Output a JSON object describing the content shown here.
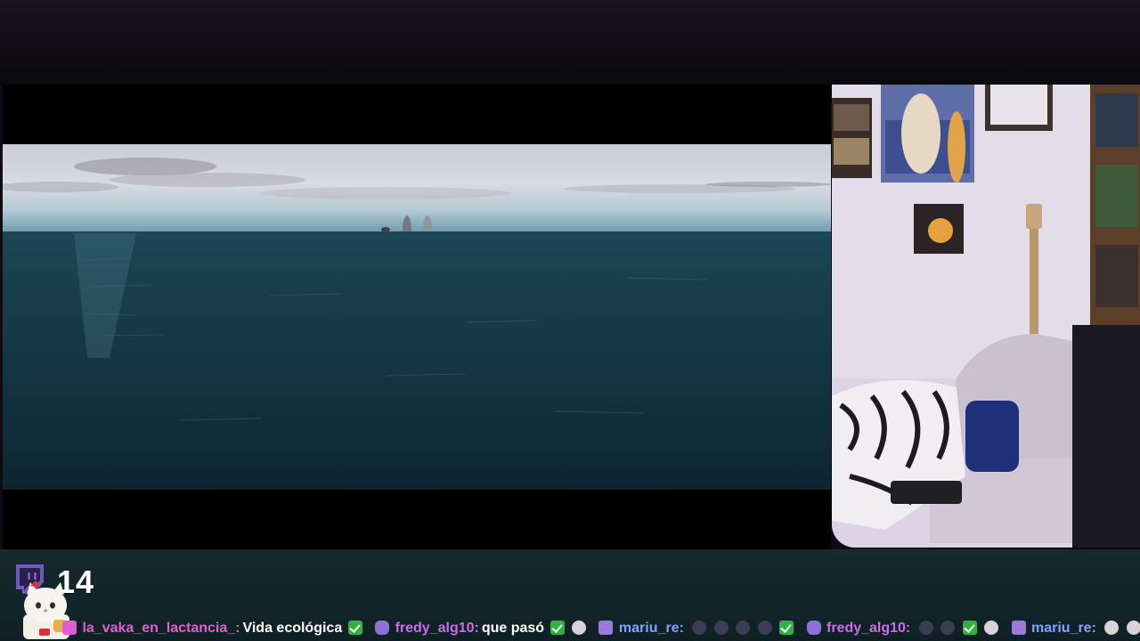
{
  "stream": {
    "viewer_count": "14",
    "platform_icon": "twitch-icon",
    "colors": {
      "username": "#c86ee6",
      "message": "#ffffff",
      "check_emote": "#2fb340"
    }
  },
  "chat": {
    "messages": [
      {
        "user": "la_vaka_en_lactancia_:",
        "text": "Vida ecológica"
      },
      {
        "user": "fredy_alg10:",
        "text": "que pasó"
      },
      {
        "user": "mariu_re:",
        "text": ""
      },
      {
        "user": "fredy_alg10:",
        "text": ""
      },
      {
        "user": "mariu_re:",
        "text": ""
      }
    ]
  }
}
